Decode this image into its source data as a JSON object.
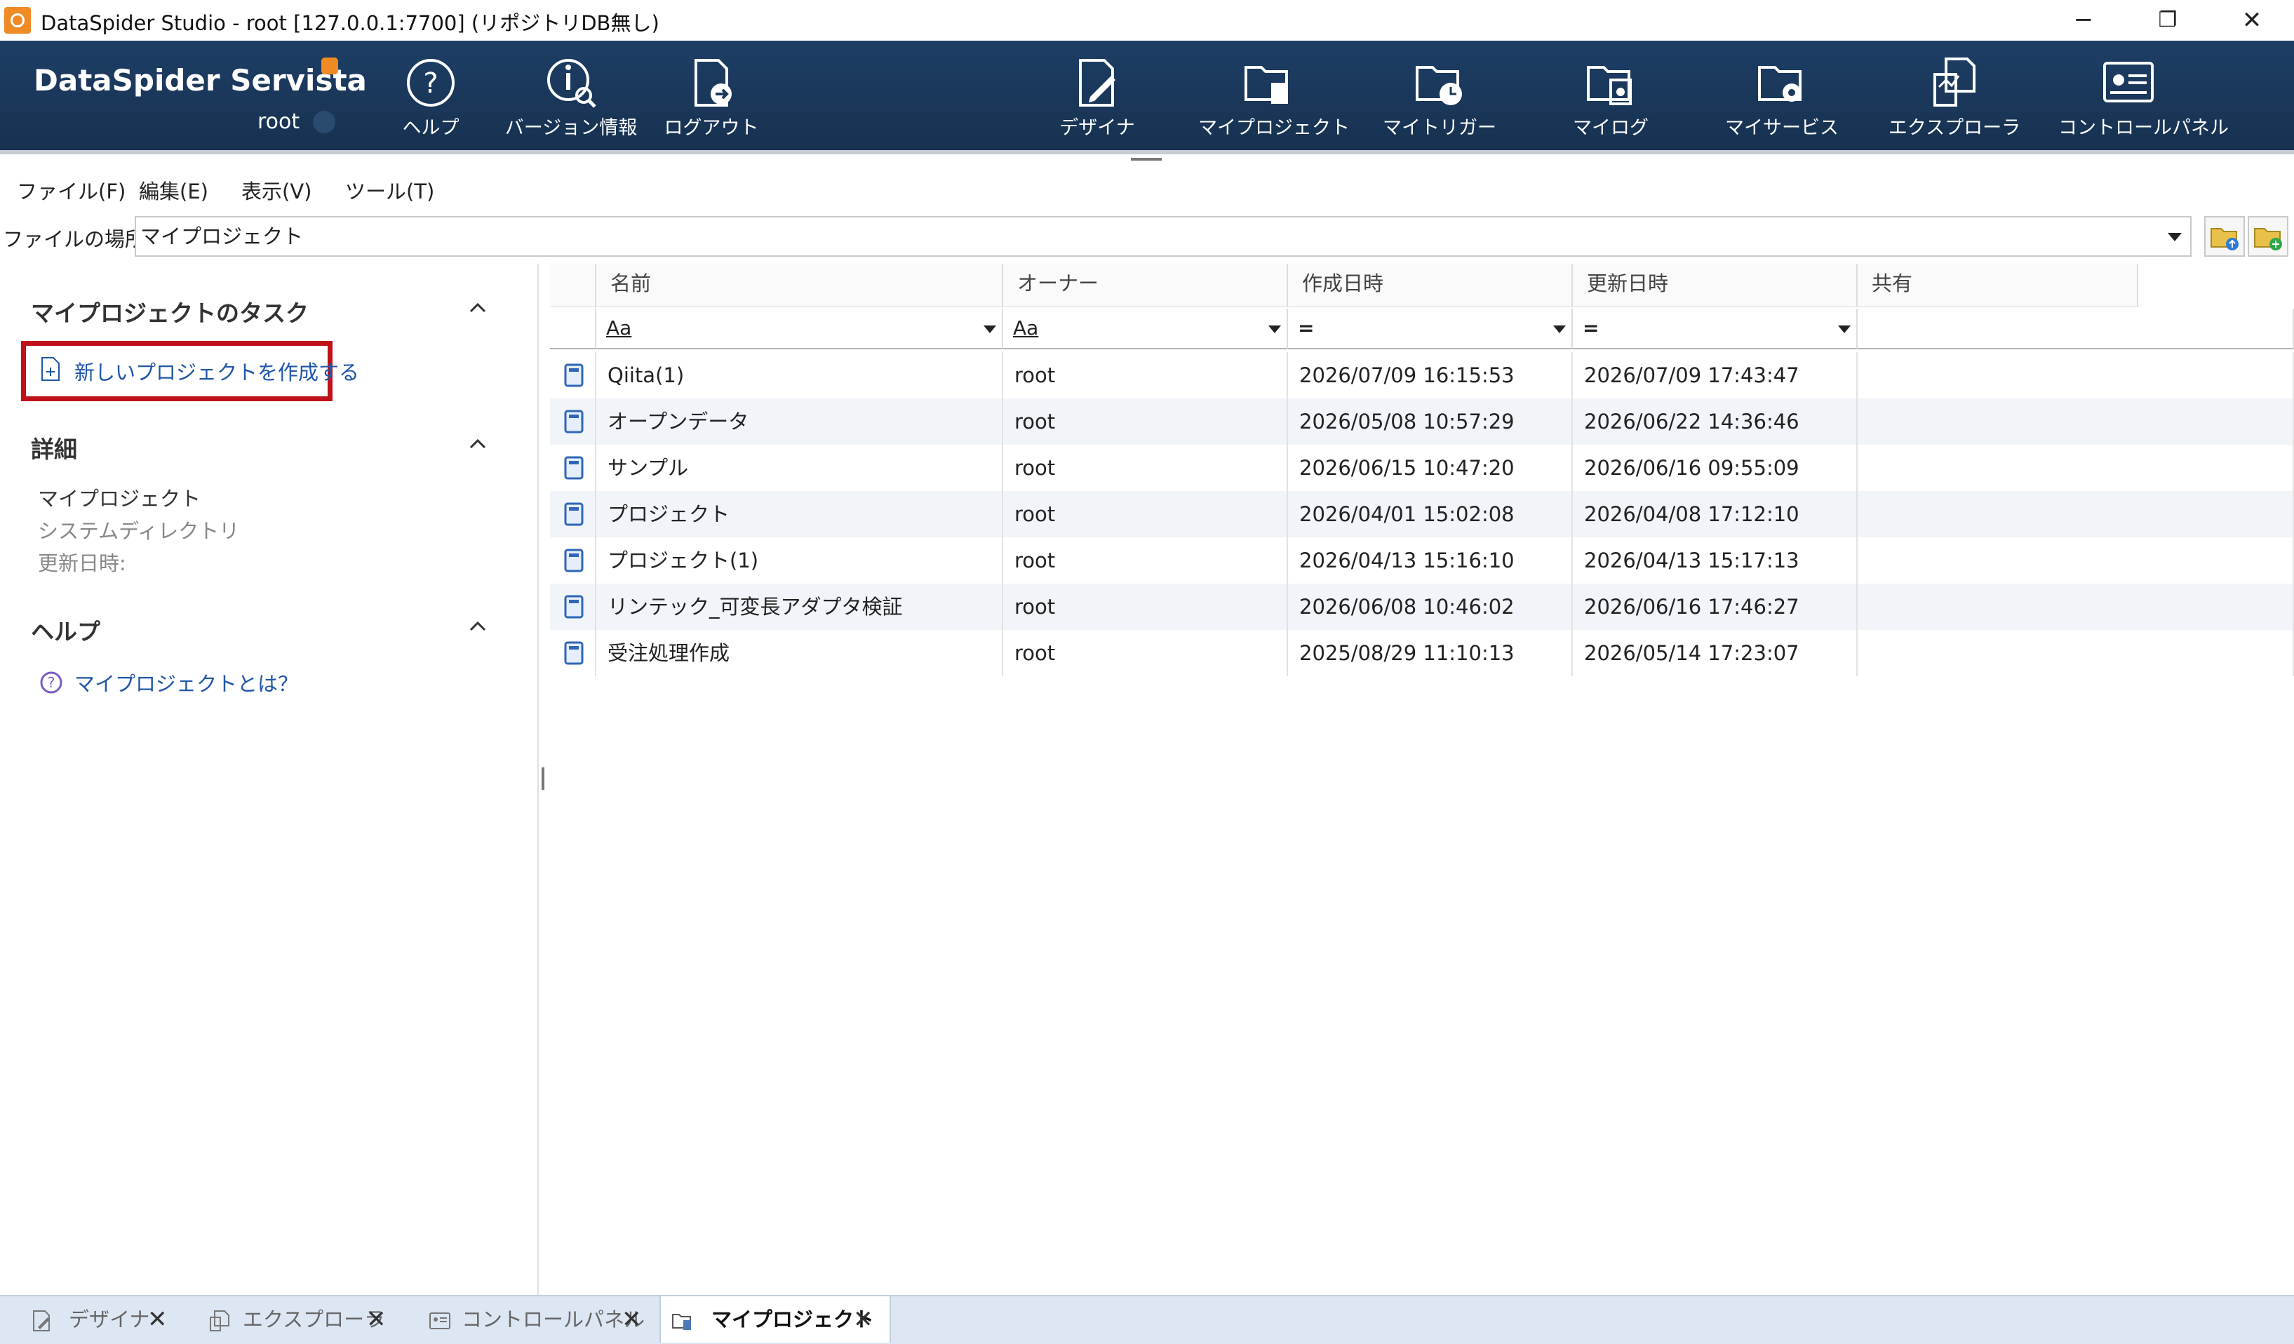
{
  "window": {
    "title": "DataSpider Studio - root [127.0.0.1:7700] (リポジトリDB無し)",
    "minimize": "─",
    "restore": "❐",
    "close": "✕"
  },
  "ribbon": {
    "brand": "DataSpider Servista",
    "user": "root",
    "items": [
      {
        "label": "ヘルプ",
        "icon": "help-circle-icon"
      },
      {
        "label": "バージョン情報",
        "icon": "version-info-icon"
      },
      {
        "label": "ログアウト",
        "icon": "logout-icon"
      },
      {
        "label": "デザイナ",
        "icon": "designer-icon"
      },
      {
        "label": "マイプロジェクト",
        "icon": "my-project-icon"
      },
      {
        "label": "マイトリガー",
        "icon": "my-trigger-icon"
      },
      {
        "label": "マイログ",
        "icon": "my-log-icon"
      },
      {
        "label": "マイサービス",
        "icon": "my-service-icon"
      },
      {
        "label": "エクスプローラ",
        "icon": "explorer-icon"
      },
      {
        "label": "コントロールパネル",
        "icon": "control-panel-icon"
      }
    ]
  },
  "menu": [
    "ファイル(F)",
    "編集(E)",
    "表示(V)",
    "ツール(T)"
  ],
  "location": {
    "label": "ファイルの場所",
    "value": "マイプロジェクト"
  },
  "left_pane": {
    "tasks_title": "マイプロジェクトのタスク",
    "new_project": "新しいプロジェクトを作成する",
    "details_title": "詳細",
    "details": {
      "name": "マイプロジェクト",
      "type": "システムディレクトリ",
      "updated_label": "更新日時:"
    },
    "help_title": "ヘルプ",
    "help_link": "マイプロジェクトとは？"
  },
  "table": {
    "columns": [
      "名前",
      "オーナー",
      "作成日時",
      "更新日時",
      "共有"
    ],
    "filters": [
      "Aa",
      "Aa",
      "=",
      "="
    ],
    "rows": [
      {
        "name": "Qiita(1)",
        "owner": "root",
        "created": "2026/07/09 16:15:53",
        "updated": "2026/07/09 17:43:47",
        "shared": ""
      },
      {
        "name": "オープンデータ",
        "owner": "root",
        "created": "2026/05/08 10:57:29",
        "updated": "2026/06/22 14:36:46",
        "shared": ""
      },
      {
        "name": "サンプル",
        "owner": "root",
        "created": "2026/06/15 10:47:20",
        "updated": "2026/06/16 09:55:09",
        "shared": ""
      },
      {
        "name": "プロジェクト",
        "owner": "root",
        "created": "2026/04/01 15:02:08",
        "updated": "2026/04/08 17:12:10",
        "shared": ""
      },
      {
        "name": "プロジェクト(1)",
        "owner": "root",
        "created": "2026/04/13 15:16:10",
        "updated": "2026/04/13 15:17:13",
        "shared": ""
      },
      {
        "name": "リンテック_可変長アダプタ検証",
        "owner": "root",
        "created": "2026/06/08 10:46:02",
        "updated": "2026/06/16 17:46:27",
        "shared": ""
      },
      {
        "name": "受注処理作成",
        "owner": "root",
        "created": "2025/08/29 11:10:13",
        "updated": "2026/05/14 17:23:07",
        "shared": ""
      }
    ]
  },
  "bottom_tabs": [
    {
      "label": "デザイナ",
      "icon": "designer-icon",
      "active": false
    },
    {
      "label": "エクスプローラ",
      "icon": "explorer-icon",
      "active": false
    },
    {
      "label": "コントロールパネル",
      "icon": "control-panel-icon",
      "active": false
    },
    {
      "label": "マイプロジェクト",
      "icon": "my-project-icon",
      "active": true
    }
  ],
  "colors": {
    "ribbon_bg": "#1b3859",
    "link": "#1f56a8",
    "highlight_box": "#c0101a",
    "accent": "#f08a24"
  }
}
